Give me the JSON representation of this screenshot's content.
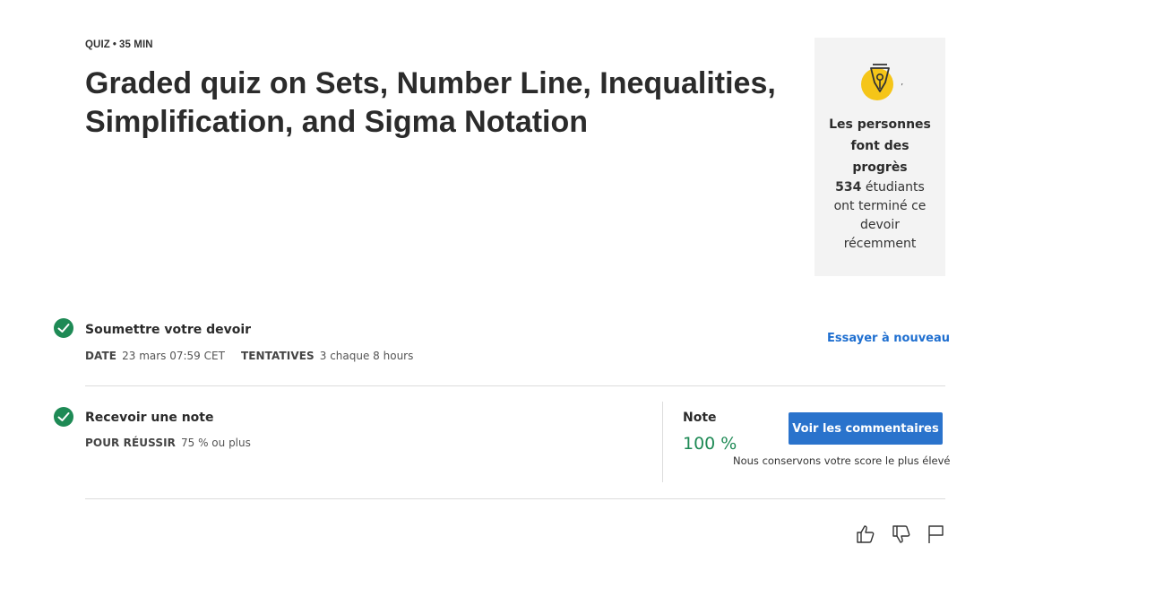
{
  "header": {
    "type": "QUIZ",
    "separator": "•",
    "duration": "35  MIN",
    "title_line1": "Graded quiz on Sets, Number Line, Inequalities,",
    "title_line2": "Simplification, and Sigma Notation"
  },
  "progress_card": {
    "icon": "pen-nib-icon",
    "mark": "’",
    "headline": [
      "Les personnes",
      "font des",
      "progrès"
    ],
    "count": "534",
    "stat_line1": " étudiants",
    "stat_line2": "ont terminé ce",
    "stat_line3": "devoir",
    "stat_line4": "récemment"
  },
  "submit": {
    "title": "Soumettre votre devoir",
    "date_label": "DATE",
    "date_value": "23 mars 07:59 CET",
    "attempts_label": "TENTATIVES",
    "attempts_value": "3 chaque 8  hours",
    "retry_label": "Essayer à nouveau"
  },
  "grade": {
    "title": "Recevoir une note",
    "pass_label": "POUR RÉUSSIR",
    "pass_value": "75 % ou plus",
    "note_label": "Note",
    "note_value": "100 %",
    "feedback_button": "Voir les commentaires",
    "keep_note": "Nous conservons votre score le plus élevé"
  },
  "colors": {
    "accent": "#2a73cc",
    "success": "#1e8a55",
    "emblem": "#f5c518"
  },
  "feedback_icons": [
    "thumbs-up-icon",
    "thumbs-down-icon",
    "flag-icon"
  ]
}
